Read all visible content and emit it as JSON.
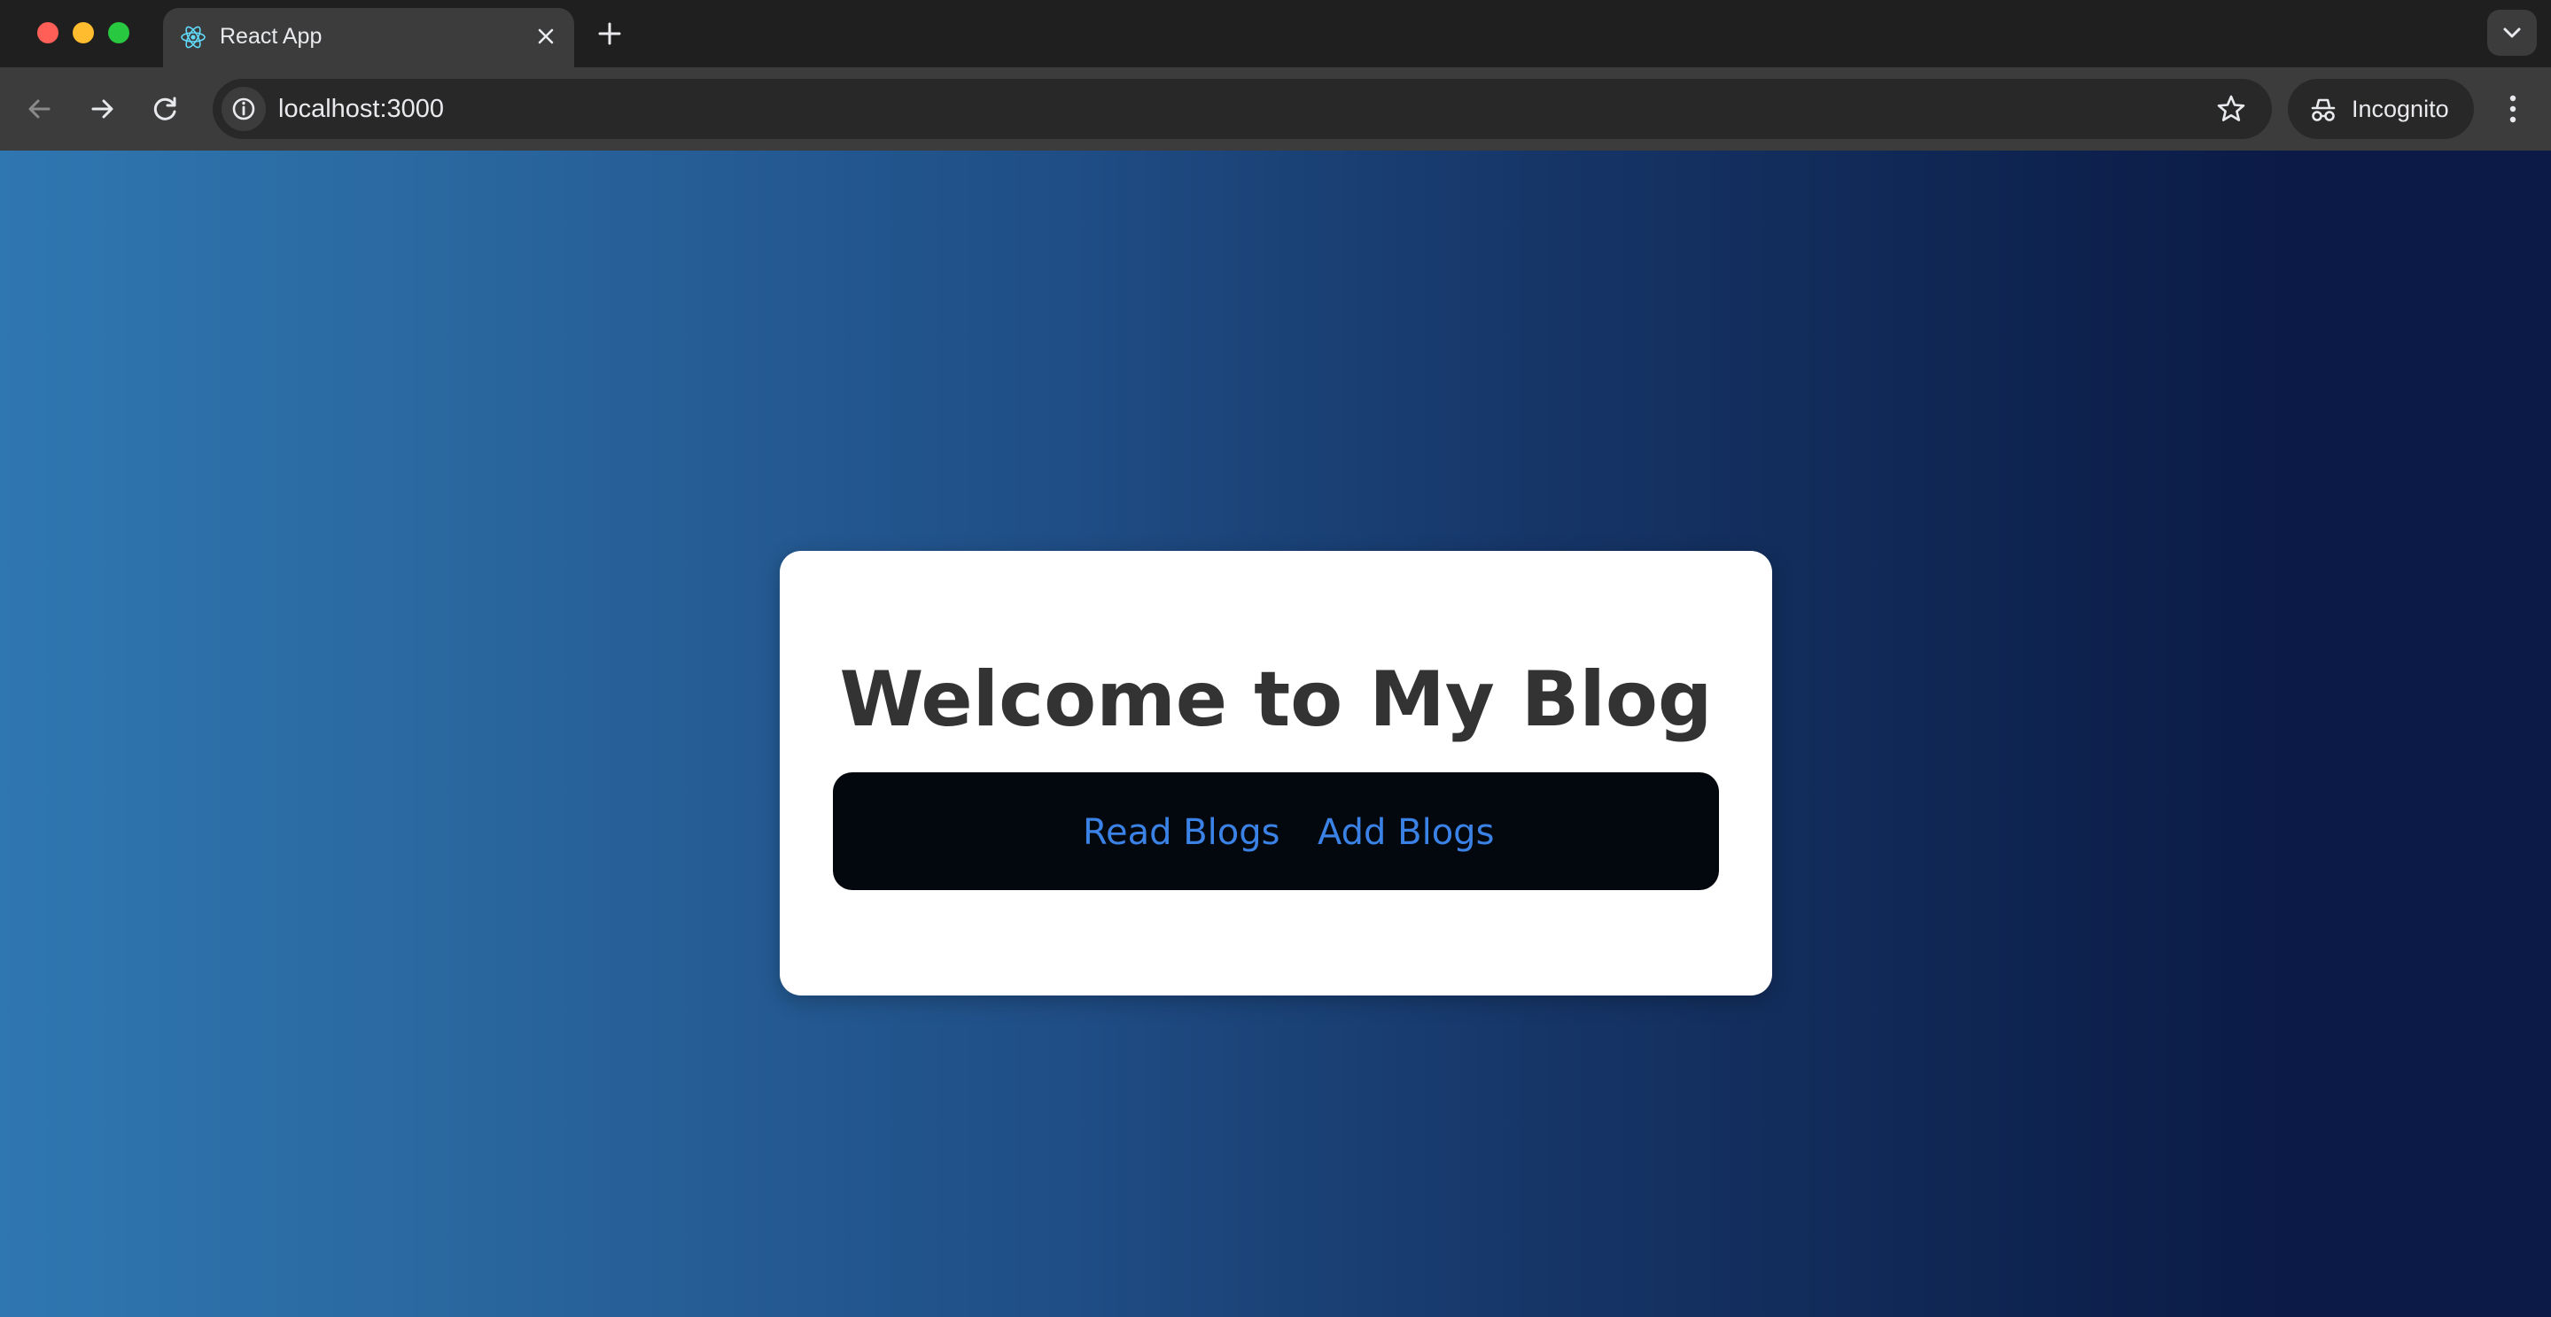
{
  "browser": {
    "tab": {
      "title": "React App",
      "favicon": "react-logo-icon",
      "close_icon": "close-icon"
    },
    "new_tab_icon": "plus-icon",
    "tab_search_icon": "chevron-down-icon",
    "toolbar": {
      "back_icon": "back-arrow-icon",
      "forward_icon": "forward-arrow-icon",
      "reload_icon": "reload-icon",
      "site_info_icon": "info-icon",
      "url": "localhost:3000",
      "bookmark_icon": "star-icon",
      "incognito_label": "Incognito",
      "incognito_icon": "incognito-icon",
      "menu_icon": "vertical-dots-icon"
    },
    "traffic_lights": [
      "#ff5f57",
      "#febc2e",
      "#28c840"
    ]
  },
  "page": {
    "title": "Welcome to My Blog",
    "nav": {
      "links": [
        {
          "label": "Read Blogs"
        },
        {
          "label": "Add Blogs"
        }
      ]
    },
    "colors": {
      "link": "#3b82e6",
      "navbar_bg": "#03070e",
      "title_text": "#333333",
      "gradient_left": "#2f77b1",
      "gradient_right": "#0b1a46"
    }
  }
}
